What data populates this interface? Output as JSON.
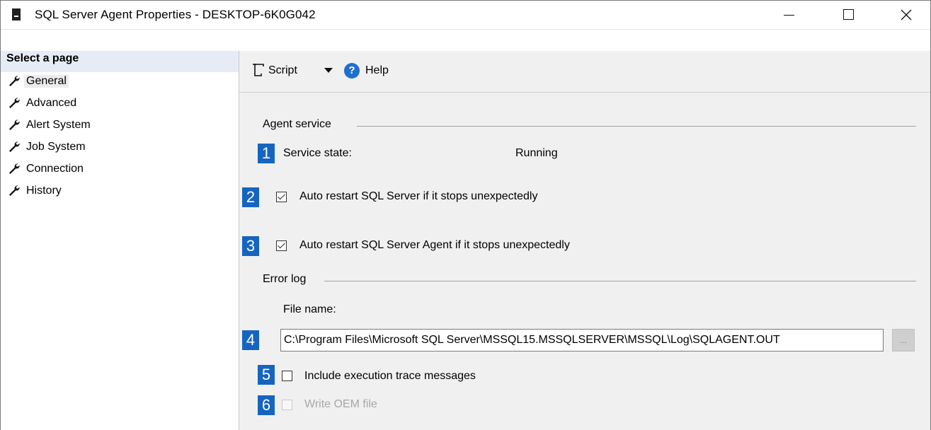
{
  "window": {
    "title": "SQL Server Agent Properties - DESKTOP-6K0G042"
  },
  "left_pane": {
    "header": "Select a page",
    "items": [
      {
        "label": "General",
        "selected": true
      },
      {
        "label": "Advanced"
      },
      {
        "label": "Alert System"
      },
      {
        "label": "Job System"
      },
      {
        "label": "Connection"
      },
      {
        "label": "History"
      }
    ]
  },
  "toolbar": {
    "script_label": "Script",
    "help_label": "Help"
  },
  "agent_service": {
    "group_label": "Agent service",
    "service_state_label": "Service state:",
    "service_state_value": "Running",
    "auto_restart_sql_label": "Auto restart SQL Server if it stops unexpectedly",
    "auto_restart_sql_checked": true,
    "auto_restart_agent_label": "Auto restart SQL Server Agent if it stops unexpectedly",
    "auto_restart_agent_checked": true
  },
  "error_log": {
    "group_label": "Error log",
    "file_name_label": "File name:",
    "file_name_value": "C:\\Program Files\\Microsoft SQL Server\\MSSQL15.MSSQLSERVER\\MSSQL\\Log\\SQLAGENT.OUT",
    "browse_label": "...",
    "include_trace_label": "Include execution trace messages",
    "include_trace_checked": false,
    "write_oem_label": "Write OEM file",
    "write_oem_checked": false,
    "write_oem_enabled": false
  },
  "badges": [
    "1",
    "2",
    "3",
    "4",
    "5",
    "6"
  ],
  "colors": {
    "badge": "#1565c0",
    "left_header_bg": "#e6ecf5",
    "pane_bg": "#f0f0f0",
    "help_icon": "#1e6fd0"
  }
}
